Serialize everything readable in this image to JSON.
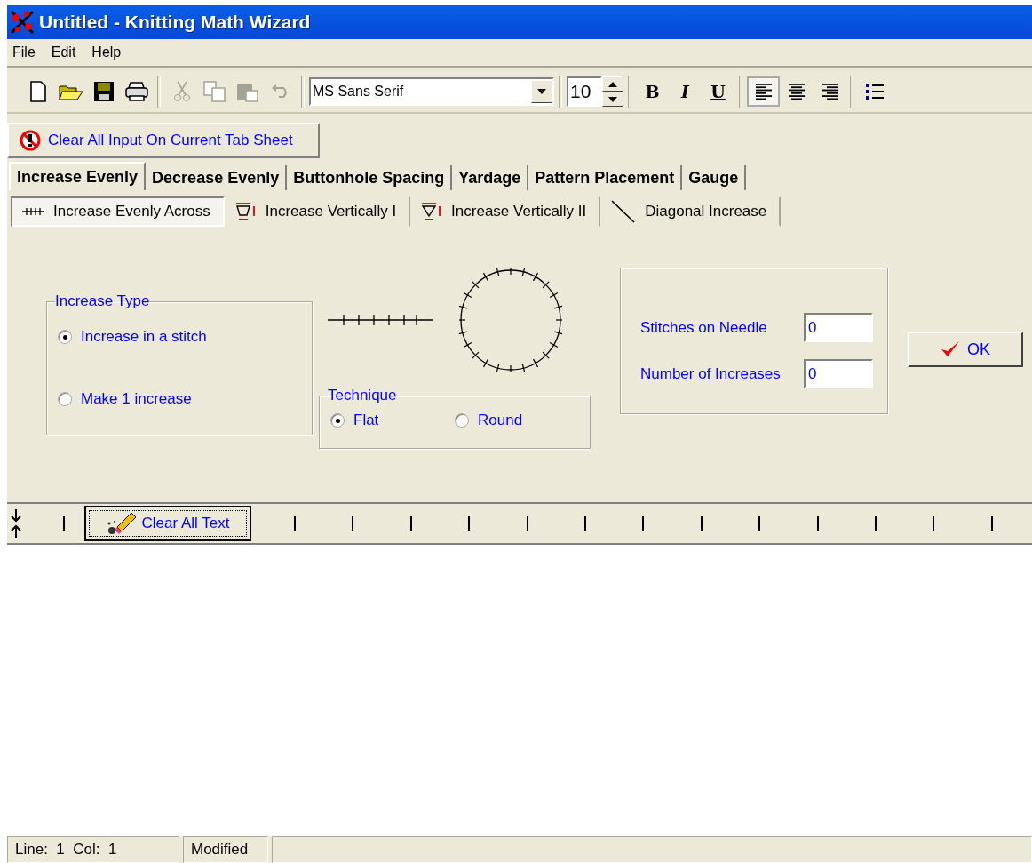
{
  "window": {
    "title": "Untitled - Knitting Math Wizard"
  },
  "menu": [
    "File",
    "Edit",
    "Help"
  ],
  "toolbar": {
    "edit_buttons": [
      {
        "disabled": true
      },
      {
        "disabled": true
      },
      {
        "disabled": true
      },
      {
        "disabled": true
      }
    ],
    "font": "MS Sans Serif",
    "font_size": "10",
    "format_buttons": [
      "B",
      "I",
      "U"
    ],
    "alignment": [
      {
        "selected": true
      },
      {
        "selected": false
      },
      {
        "selected": false
      }
    ]
  },
  "clear_input_button": "Clear All Input On Current Tab Sheet",
  "tabs": [
    {
      "label": "Increase Evenly",
      "selected": true
    },
    {
      "label": "Decrease Evenly",
      "selected": false
    },
    {
      "label": "Buttonhole Spacing",
      "selected": false
    },
    {
      "label": "Yardage",
      "selected": false
    },
    {
      "label": "Pattern Placement",
      "selected": false
    },
    {
      "label": "Gauge",
      "selected": false
    }
  ],
  "subtabs": [
    {
      "label": "Increase Evenly Across",
      "selected": true
    },
    {
      "label": "Increase Vertically I",
      "selected": false
    },
    {
      "label": "Increase Vertically II",
      "selected": false
    },
    {
      "label": "Diagonal Increase",
      "selected": false
    }
  ],
  "increase_type": {
    "title": "Increase Type",
    "options": [
      {
        "label": "Increase in a stitch",
        "selected": true
      },
      {
        "label": "Make 1 increase",
        "selected": false
      }
    ]
  },
  "technique": {
    "title": "Technique",
    "options": [
      {
        "label": "Flat",
        "selected": true
      },
      {
        "label": "Round",
        "selected": false
      }
    ]
  },
  "fields": [
    {
      "label": "Stitches on Needle",
      "value": "0"
    },
    {
      "label": "Number of Increases",
      "value": "0"
    }
  ],
  "ok_button": "OK",
  "clear_text_button": "Clear All Text",
  "status_bar": [
    "Line:  1  Col:  1",
    "Modified"
  ]
}
